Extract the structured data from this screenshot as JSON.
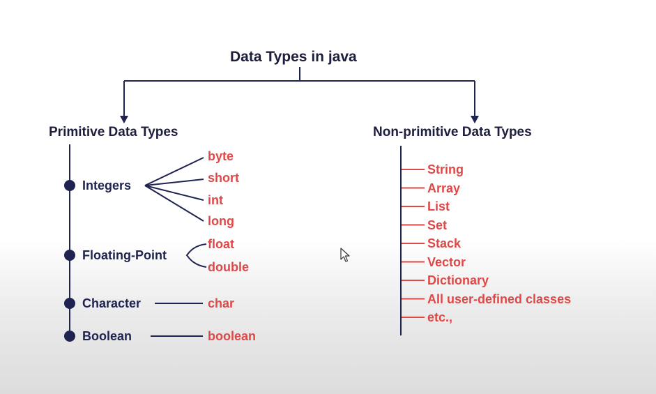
{
  "title": "Data Types in java",
  "primitive": {
    "heading": "Primitive Data Types",
    "categories": [
      {
        "label": "Integers",
        "types": [
          "byte",
          "short",
          "int",
          "long"
        ]
      },
      {
        "label": "Floating-Point",
        "types": [
          "float",
          "double"
        ]
      },
      {
        "label": "Character",
        "types": [
          "char"
        ]
      },
      {
        "label": "Boolean",
        "types": [
          "boolean"
        ]
      }
    ]
  },
  "non_primitive": {
    "heading": "Non-primitive Data Types",
    "types": [
      "String",
      "Array",
      "List",
      "Set",
      "Stack",
      "Vector",
      "Dictionary",
      "All user-defined classes",
      "etc.,"
    ]
  },
  "colors": {
    "navy": "#1d1d3d",
    "red": "#e04848",
    "line": "#1f2350"
  },
  "icons": {
    "cursor": "mouse-pointer-icon"
  }
}
